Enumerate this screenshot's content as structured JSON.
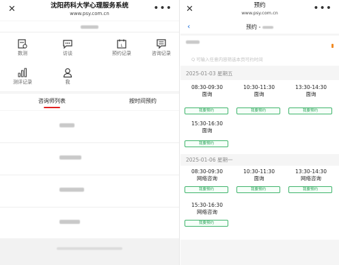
{
  "left": {
    "title": "沈阳药科大学心理服务系统",
    "url": "www.psy.com.cn",
    "grid": [
      {
        "label": "数测"
      },
      {
        "label": "访谈"
      },
      {
        "label": "预约记录"
      },
      {
        "label": "咨询记录"
      },
      {
        "label": "测评记录"
      },
      {
        "label": "我"
      }
    ],
    "tabs": {
      "active": "咨询师列表",
      "other": "按时间预约"
    }
  },
  "right": {
    "title": "预约",
    "url": "www.psy.com.cn",
    "nav_title_prefix": "预约 - ",
    "search_placeholder": "Q 可输入任意内容筛选本页可约时间",
    "sections": [
      {
        "date": "2025-01-03 星期五",
        "slots": [
          {
            "time": "08:30-09:30",
            "type": "面询",
            "button": "我要预约"
          },
          {
            "time": "10:30-11:30",
            "type": "面询",
            "button": "我要预约"
          },
          {
            "time": "13:30-14:30",
            "type": "面询",
            "button": "我要预约"
          },
          {
            "time": "15:30-16:30",
            "type": "面询",
            "button": "我要预约"
          }
        ]
      },
      {
        "date": "2025-01-06 星期一",
        "slots": [
          {
            "time": "08:30-09:30",
            "type": "网络咨询",
            "button": "我要预约"
          },
          {
            "time": "10:30-11:30",
            "type": "面询",
            "button": "我要预约"
          },
          {
            "time": "13:30-14:30",
            "type": "网络咨询",
            "button": "我要预约"
          },
          {
            "time": "15:30-16:30",
            "type": "网络咨询",
            "button": "我要预约"
          }
        ]
      }
    ]
  },
  "colors": {
    "accent_red": "#e02020",
    "link_blue": "#1e6fd9",
    "button_green": "#3db36a",
    "badge_orange": "#f08a24"
  }
}
